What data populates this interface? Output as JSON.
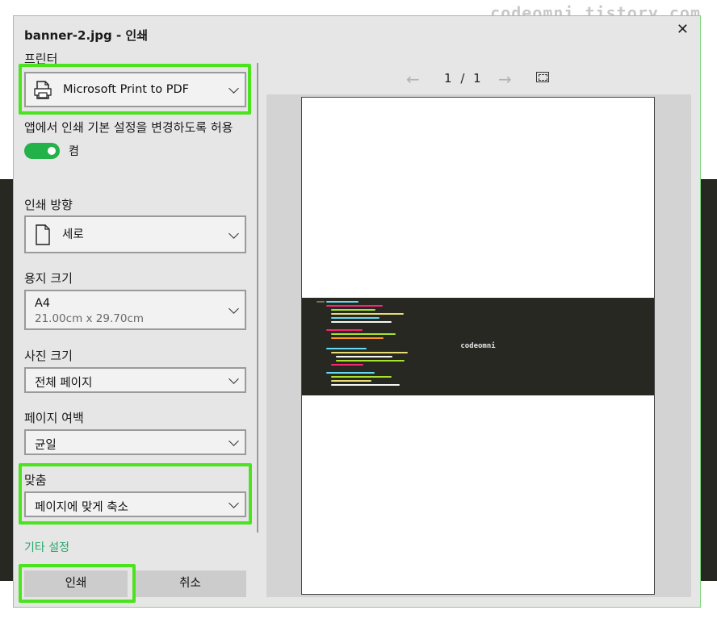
{
  "watermark": "codeomni.tistory.com",
  "dialog": {
    "title": "banner-2.jpg - 인쇄",
    "close_glyph": "✕",
    "printer": {
      "label": "프린터",
      "value": "Microsoft Print to PDF",
      "icon": "printer-icon"
    },
    "app_settings": {
      "label": "앱에서 인쇄 기본 설정을 변경하도록 허용",
      "state": "켬",
      "on": true
    },
    "orientation": {
      "label": "인쇄 방향",
      "value": "세로",
      "icon": "page-icon"
    },
    "paper_size": {
      "label": "용지 크기",
      "value": "A4",
      "sub": "21.00cm x 29.70cm"
    },
    "photo_size": {
      "label": "사진 크기",
      "value": "전체 페이지"
    },
    "margins": {
      "label": "페이지 여백",
      "value": "균일"
    },
    "fit": {
      "label": "맞춤",
      "value": "페이지에 맞게 축소"
    },
    "more_settings": "기타 설정",
    "buttons": {
      "print": "인쇄",
      "cancel": "취소"
    }
  },
  "preview": {
    "prev_glyph": "←",
    "next_glyph": "→",
    "page_current": "1",
    "page_sep": "/",
    "page_total": "1",
    "banner_text": "codeomni"
  },
  "colors": {
    "accent_green": "#23b24a",
    "highlight": "#4be31e",
    "link": "#23a86a",
    "code_bg": "#272822"
  }
}
